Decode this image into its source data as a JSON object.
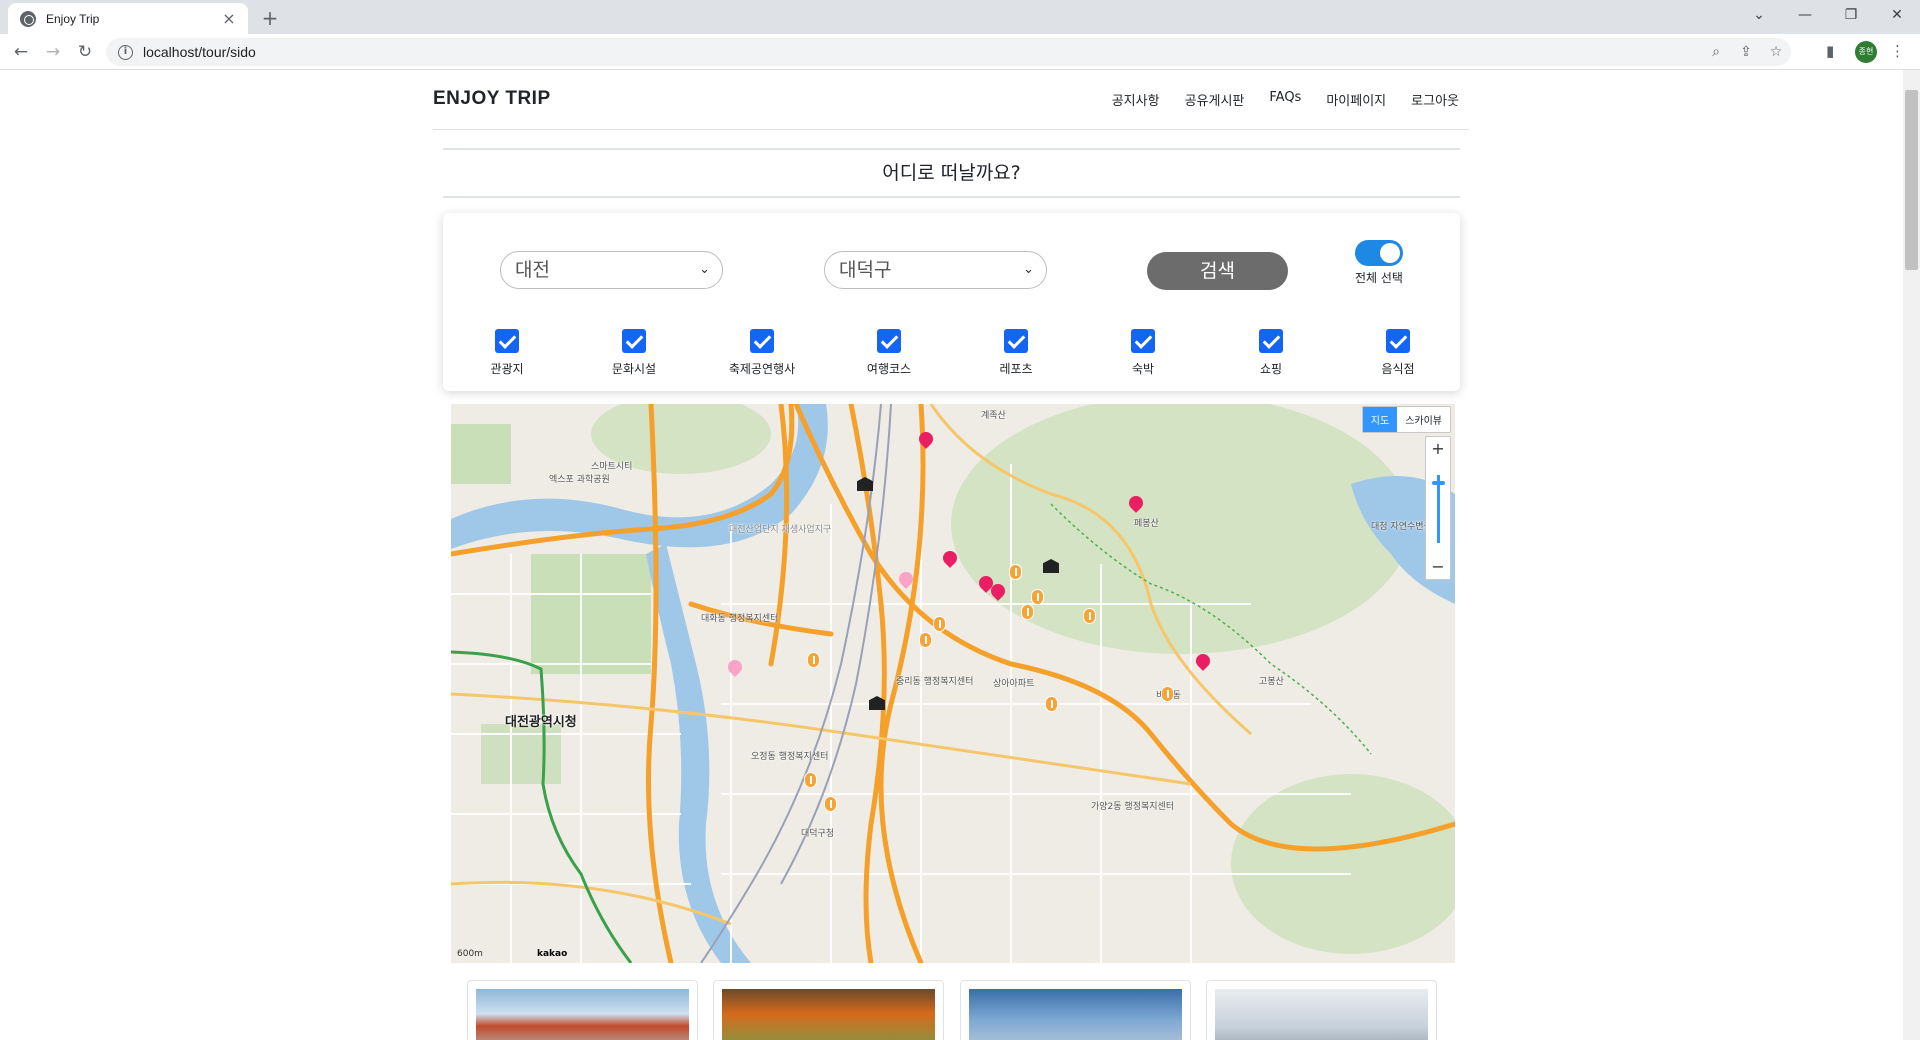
{
  "browser": {
    "tab_title": "Enjoy Trip",
    "url": "localhost/tour/sido",
    "avatar_text": "종현"
  },
  "header": {
    "brand": "ENJOY TRIP",
    "nav": [
      "공지사항",
      "공유게시판",
      "FAQs",
      "마이페이지",
      "로그아웃"
    ]
  },
  "headline": "어디로 떠날까요?",
  "search": {
    "sido_selected": "대전",
    "gugun_selected": "대덕구",
    "search_label": "검색",
    "toggle_label": "전체 선택",
    "toggle_on": true,
    "categories": [
      {
        "label": "관광지",
        "checked": true
      },
      {
        "label": "문화시설",
        "checked": true
      },
      {
        "label": "축제공연행사",
        "checked": true
      },
      {
        "label": "여행코스",
        "checked": true
      },
      {
        "label": "레포츠",
        "checked": true
      },
      {
        "label": "숙박",
        "checked": true
      },
      {
        "label": "쇼핑",
        "checked": true
      },
      {
        "label": "음식점",
        "checked": true
      }
    ]
  },
  "map": {
    "type_map": "지도",
    "type_skyview": "스카이뷰",
    "zoom_in": "+",
    "zoom_out": "−",
    "scale_text": "600m",
    "provider": "kakao",
    "labels": {
      "city_hall": "대전광역시청",
      "mountain1": "계족산",
      "mountain2": "고봉산",
      "mountain3": "페봉산",
      "area1": "대전산업단지\n재생사업지구",
      "lake": "대청\n자연수변공원",
      "area2": "대덕구청",
      "area3": "오정동\n행정복지센터",
      "area4": "중리동\n행정복지센터",
      "area5": "대화동\n행정복지센터",
      "area6": "가양2동\n행정복지센터",
      "area7": "스마트시티",
      "area8": "엑스포\n과학공원",
      "area9": "상아아파트",
      "area10": "비래동"
    },
    "colors": {
      "road_major": "#f4a02a",
      "road_minor": "#ffffff",
      "river": "#9fc7e8",
      "park": "#c8dfb8",
      "land": "#eeece4"
    }
  },
  "cards_count": 4
}
